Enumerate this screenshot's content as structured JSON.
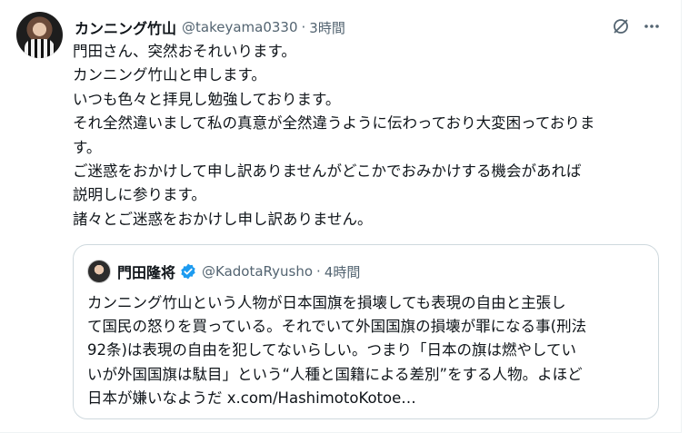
{
  "tweet": {
    "author_name": "カンニング竹山",
    "author_handle": "@takeyama0330",
    "separator": "·",
    "time": "3時間",
    "lines": [
      "門田さん、突然おそれいります。",
      "カンニング竹山と申します。",
      "いつも色々と拝見し勉強しております。",
      "それ全然違いまして私の真意が全然違うように伝わっており大変困っておりま",
      "す。",
      "ご迷惑をおかけして申し訳ありませんがどこかでおみかけする機会があれば",
      "説明しに参ります。",
      "諸々とご迷惑をおかけし申し訳ありません。"
    ],
    "icons": {
      "grok": "grok-icon",
      "more": "more-icon",
      "verified": "verified-badge-icon"
    }
  },
  "quoted": {
    "author_name": "門田隆将",
    "author_handle": "@KadotaRyusho",
    "separator": "·",
    "time": "4時間",
    "lines": [
      "カンニング竹山という人物が日本国旗を損壊しても表現の自由と主張し",
      "て国民の怒りを買っている。それでいて外国国旗の損壊が罪になる事(刑法",
      "92条)は表現の自由を犯してないらしい。つまり「日本の旗は燃やしてい",
      "いが外国国旗は駄目」という“人種と国籍による差別”をする人物。よほど",
      "日本が嫌いなようだ x.com/HashimotoKotoe…"
    ]
  },
  "colors": {
    "text": "#0f1419",
    "secondary": "#536471",
    "border": "#cfd9de",
    "verified": "#1d9bf0"
  }
}
